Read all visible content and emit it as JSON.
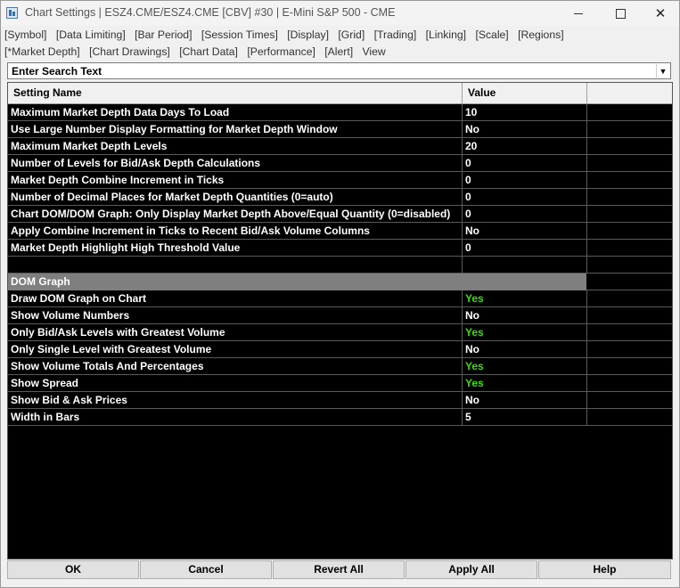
{
  "window": {
    "title": "Chart Settings | ESZ4.CME/ESZ4.CME [CBV] #30 | E-Mini S&P 500 - CME"
  },
  "menu_row1": [
    "[Symbol]",
    "[Data Limiting]",
    "[Bar Period]",
    "[Session Times]",
    "[Display]",
    "[Grid]",
    "[Trading]",
    "[Linking]",
    "[Scale]",
    "[Regions]"
  ],
  "menu_row2": [
    "[*Market Depth]",
    "[Chart Drawings]",
    "[Chart Data]",
    "[Performance]",
    "[Alert]",
    "View"
  ],
  "search": {
    "text": "Enter Search Text"
  },
  "table": {
    "headers": [
      "Setting Name",
      "Value",
      ""
    ],
    "rows": [
      {
        "name": "Maximum Market Depth Data Days To Load",
        "value": "10"
      },
      {
        "name": "Use Large Number Display Formatting for Market Depth Window",
        "value": "No"
      },
      {
        "name": "Maximum Market Depth Levels",
        "value": "20"
      },
      {
        "name": "Number of Levels for Bid/Ask Depth Calculations",
        "value": "0"
      },
      {
        "name": "Market Depth Combine Increment in Ticks",
        "value": "0"
      },
      {
        "name": "Number of Decimal Places for Market Depth Quantities (0=auto)",
        "value": "0"
      },
      {
        "name": "Chart DOM/DOM Graph: Only Display Market Depth Above/Equal Quantity (0=disabled)",
        "value": "0"
      },
      {
        "name": "Apply Combine Increment in Ticks to Recent Bid/Ask Volume Columns",
        "value": "No"
      },
      {
        "name": "Market Depth Highlight High Threshold Value",
        "value": "0"
      }
    ],
    "section_title": "DOM Graph",
    "section_rows": [
      {
        "name": "Draw DOM Graph on Chart",
        "value": "Yes"
      },
      {
        "name": "Show Volume Numbers",
        "value": "No"
      },
      {
        "name": "Only Bid/Ask Levels with Greatest Volume",
        "value": "Yes"
      },
      {
        "name": "Only Single Level with Greatest Volume",
        "value": "No"
      },
      {
        "name": "Show Volume Totals And Percentages",
        "value": "Yes"
      },
      {
        "name": "Show Spread",
        "value": "Yes"
      },
      {
        "name": "Show Bid & Ask Prices",
        "value": "No"
      },
      {
        "name": "Width in Bars",
        "value": "5"
      }
    ]
  },
  "buttons": {
    "ok": "OK",
    "cancel": "Cancel",
    "revert_all": "Revert All",
    "apply_all": "Apply All",
    "help": "Help"
  },
  "colors": {
    "yes_value": "#35e000",
    "section_bg": "#7f7f7f",
    "grid_bg": "#000000"
  }
}
